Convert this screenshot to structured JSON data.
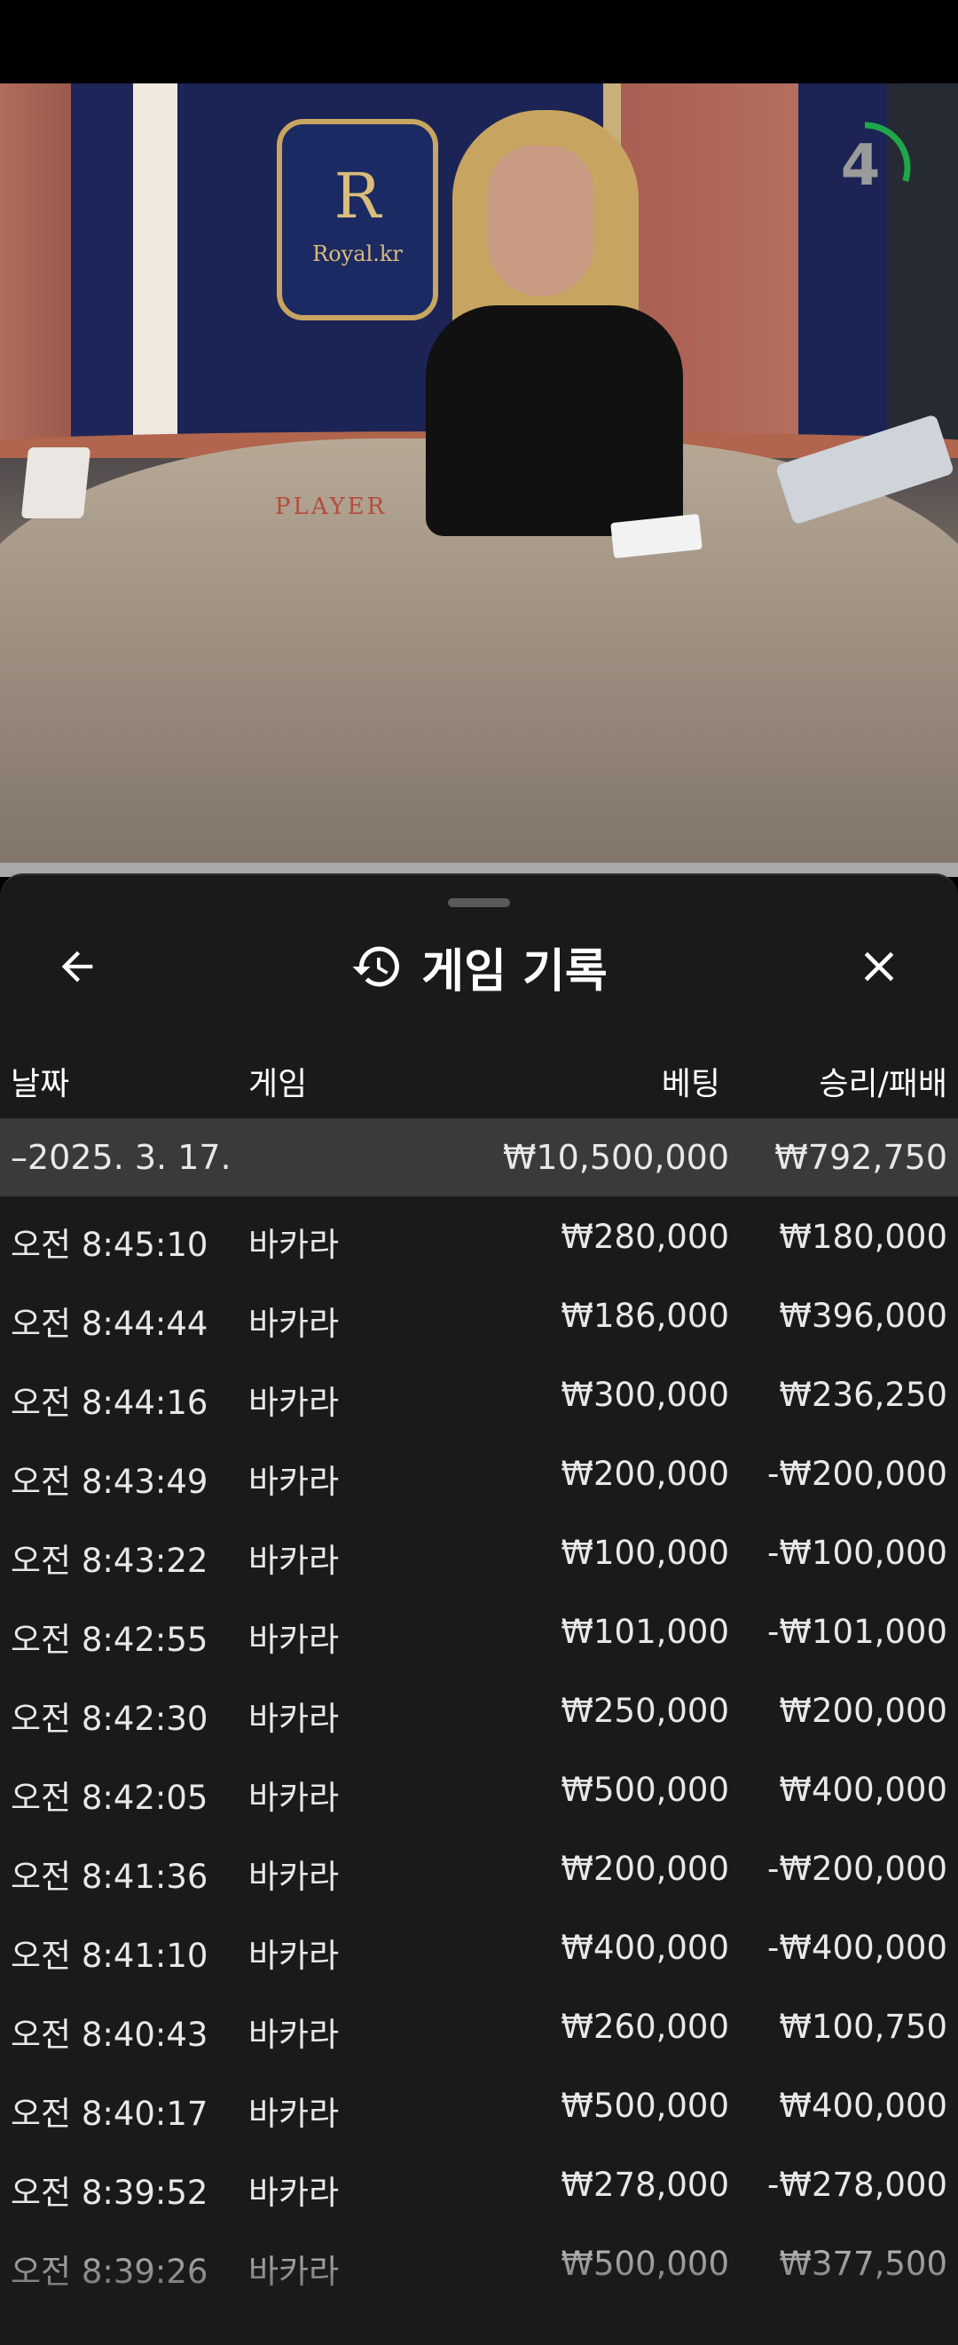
{
  "video": {
    "logo_text": "Royal.kr",
    "logo_letter": "R",
    "table_label": "PLAYER",
    "countdown": "4",
    "countdown_progress": 0.3
  },
  "history": {
    "title": "게임 기록",
    "columns": {
      "date": "날짜",
      "game": "게임",
      "bet": "베팅",
      "result": "승리/패배"
    },
    "summary": {
      "date": "–2025. 3. 17.",
      "bet": "₩10,500,000",
      "result": "₩792,750"
    },
    "rows": [
      {
        "time": "오전 8:45:10",
        "game": "바카라",
        "bet": "₩280,000",
        "result": "₩180,000"
      },
      {
        "time": "오전 8:44:44",
        "game": "바카라",
        "bet": "₩186,000",
        "result": "₩396,000"
      },
      {
        "time": "오전 8:44:16",
        "game": "바카라",
        "bet": "₩300,000",
        "result": "₩236,250"
      },
      {
        "time": "오전 8:43:49",
        "game": "바카라",
        "bet": "₩200,000",
        "result": "-₩200,000"
      },
      {
        "time": "오전 8:43:22",
        "game": "바카라",
        "bet": "₩100,000",
        "result": "-₩100,000"
      },
      {
        "time": "오전 8:42:55",
        "game": "바카라",
        "bet": "₩101,000",
        "result": "-₩101,000"
      },
      {
        "time": "오전 8:42:30",
        "game": "바카라",
        "bet": "₩250,000",
        "result": "₩200,000"
      },
      {
        "time": "오전 8:42:05",
        "game": "바카라",
        "bet": "₩500,000",
        "result": "₩400,000"
      },
      {
        "time": "오전 8:41:36",
        "game": "바카라",
        "bet": "₩200,000",
        "result": "-₩200,000"
      },
      {
        "time": "오전 8:41:10",
        "game": "바카라",
        "bet": "₩400,000",
        "result": "-₩400,000"
      },
      {
        "time": "오전 8:40:43",
        "game": "바카라",
        "bet": "₩260,000",
        "result": "₩100,750"
      },
      {
        "time": "오전 8:40:17",
        "game": "바카라",
        "bet": "₩500,000",
        "result": "₩400,000"
      },
      {
        "time": "오전 8:39:52",
        "game": "바카라",
        "bet": "₩278,000",
        "result": "-₩278,000"
      },
      {
        "time": "오전 8:39:26",
        "game": "바카라",
        "bet": "₩500,000",
        "result": "₩377,500"
      }
    ]
  }
}
